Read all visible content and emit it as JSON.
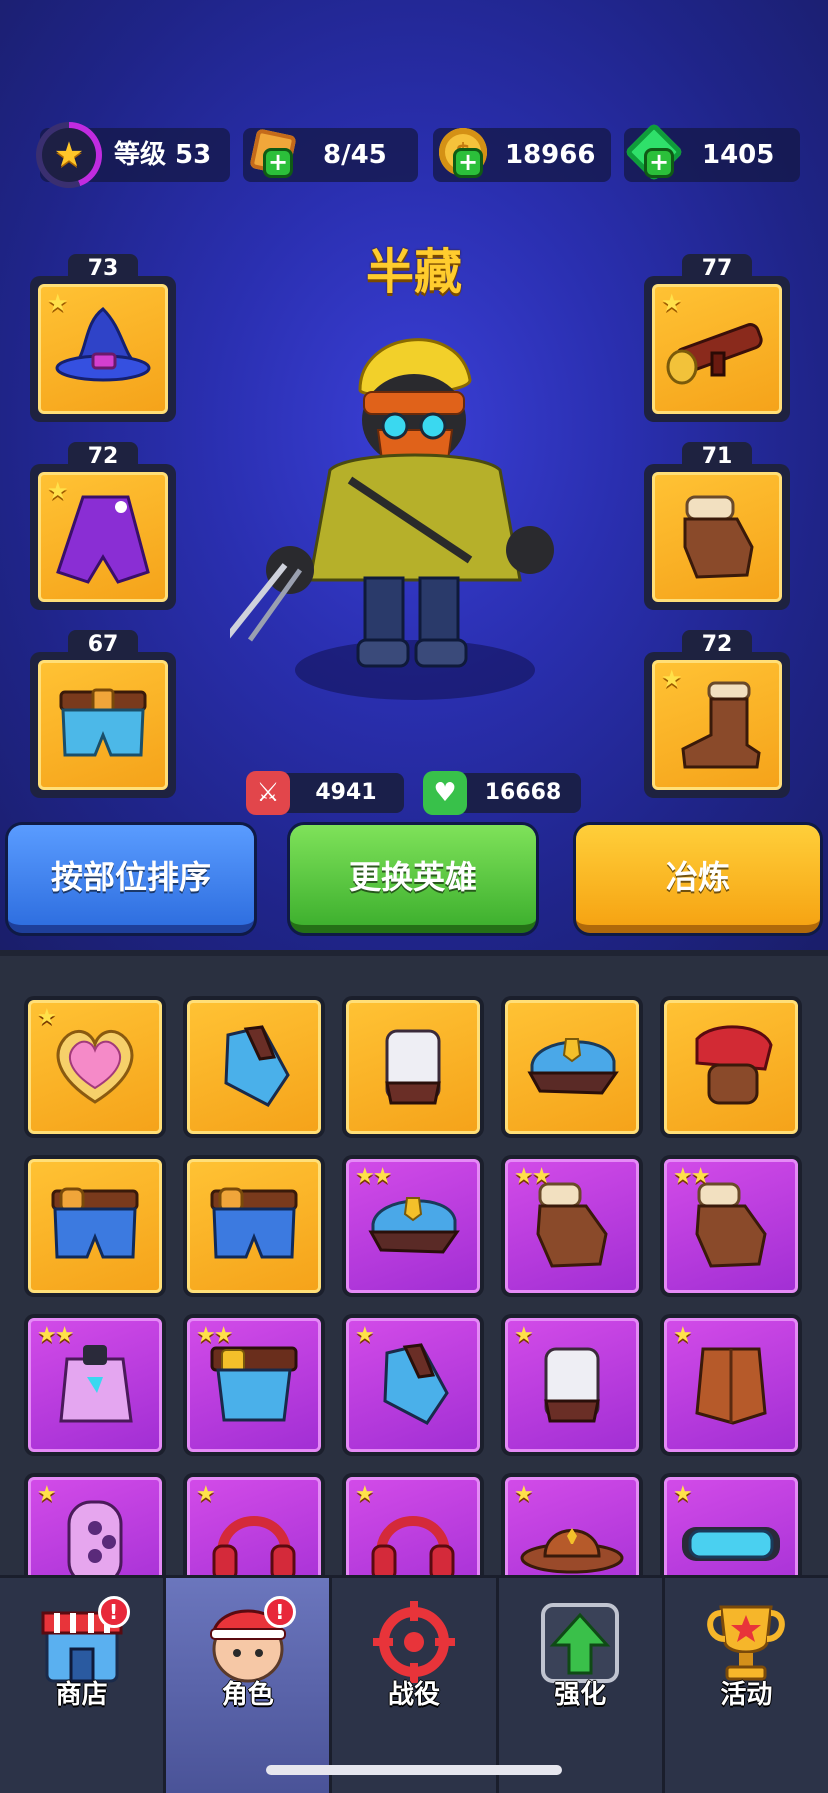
{
  "resources": {
    "level_label": "等级 53",
    "level_progress": 0.45,
    "pizza": "8/45",
    "gold": "18966",
    "gems": "1405"
  },
  "hero": {
    "name": "半藏",
    "attack": "4941",
    "health": "16668"
  },
  "equipment": {
    "left": [
      {
        "level": "73",
        "icon": "wizard-hat-icon",
        "stars": "★"
      },
      {
        "level": "72",
        "icon": "purple-cape-icon",
        "stars": "★"
      },
      {
        "level": "67",
        "icon": "shorts-icon",
        "stars": ""
      }
    ],
    "right": [
      {
        "level": "77",
        "icon": "bazooka-icon",
        "stars": "★"
      },
      {
        "level": "71",
        "icon": "glove-icon",
        "stars": ""
      },
      {
        "level": "72",
        "icon": "boot-icon",
        "stars": "★"
      }
    ]
  },
  "buttons": {
    "sort": "按部位排序",
    "change_hero": "更换英雄",
    "smelt": "冶炼"
  },
  "inventory": [
    {
      "rarity": "gold",
      "stars": "★",
      "icon": "heart-badge-icon"
    },
    {
      "rarity": "gold",
      "stars": "",
      "icon": "armor-vest-icon"
    },
    {
      "rarity": "gold",
      "stars": "",
      "icon": "white-vest-icon"
    },
    {
      "rarity": "gold",
      "stars": "",
      "icon": "police-cap-icon"
    },
    {
      "rarity": "gold",
      "stars": "",
      "icon": "bandana-icon"
    },
    {
      "rarity": "gold",
      "stars": "",
      "icon": "shorts-icon"
    },
    {
      "rarity": "gold",
      "stars": "",
      "icon": "shorts-icon"
    },
    {
      "rarity": "purple",
      "stars": "★★",
      "icon": "police-cap-icon"
    },
    {
      "rarity": "purple",
      "stars": "★★",
      "icon": "glove-icon"
    },
    {
      "rarity": "purple",
      "stars": "★★",
      "icon": "glove-icon"
    },
    {
      "rarity": "purple",
      "stars": "★★",
      "icon": "hoodie-icon"
    },
    {
      "rarity": "purple",
      "stars": "★★",
      "icon": "belt-pants-icon"
    },
    {
      "rarity": "purple",
      "stars": "★",
      "icon": "armor-vest-icon"
    },
    {
      "rarity": "purple",
      "stars": "★",
      "icon": "white-vest-icon"
    },
    {
      "rarity": "purple",
      "stars": "★",
      "icon": "leather-vest-icon"
    },
    {
      "rarity": "purple",
      "stars": "★",
      "icon": "brass-knuckles-icon"
    },
    {
      "rarity": "purple",
      "stars": "★",
      "icon": "headphones-icon"
    },
    {
      "rarity": "purple",
      "stars": "★",
      "icon": "headphones-icon"
    },
    {
      "rarity": "purple",
      "stars": "★",
      "icon": "cowboy-hat-icon"
    },
    {
      "rarity": "purple",
      "stars": "★",
      "icon": "goggles-icon"
    }
  ],
  "nav": [
    {
      "label": "商店",
      "icon": "shop-icon",
      "alert": "!",
      "active": false
    },
    {
      "label": "角色",
      "icon": "character-icon",
      "alert": "!",
      "active": true
    },
    {
      "label": "战役",
      "icon": "crosshair-icon",
      "alert": "",
      "active": false
    },
    {
      "label": "强化",
      "icon": "upgrade-arrow-icon",
      "alert": "",
      "active": false
    },
    {
      "label": "活动",
      "icon": "trophy-icon",
      "alert": "",
      "active": false
    }
  ],
  "colors": {
    "accent_gold": "#ffcc2e",
    "rarity_gold": "#f5a31a",
    "rarity_purple": "#a22fd4",
    "bg_blue": "#2a2fb0"
  }
}
